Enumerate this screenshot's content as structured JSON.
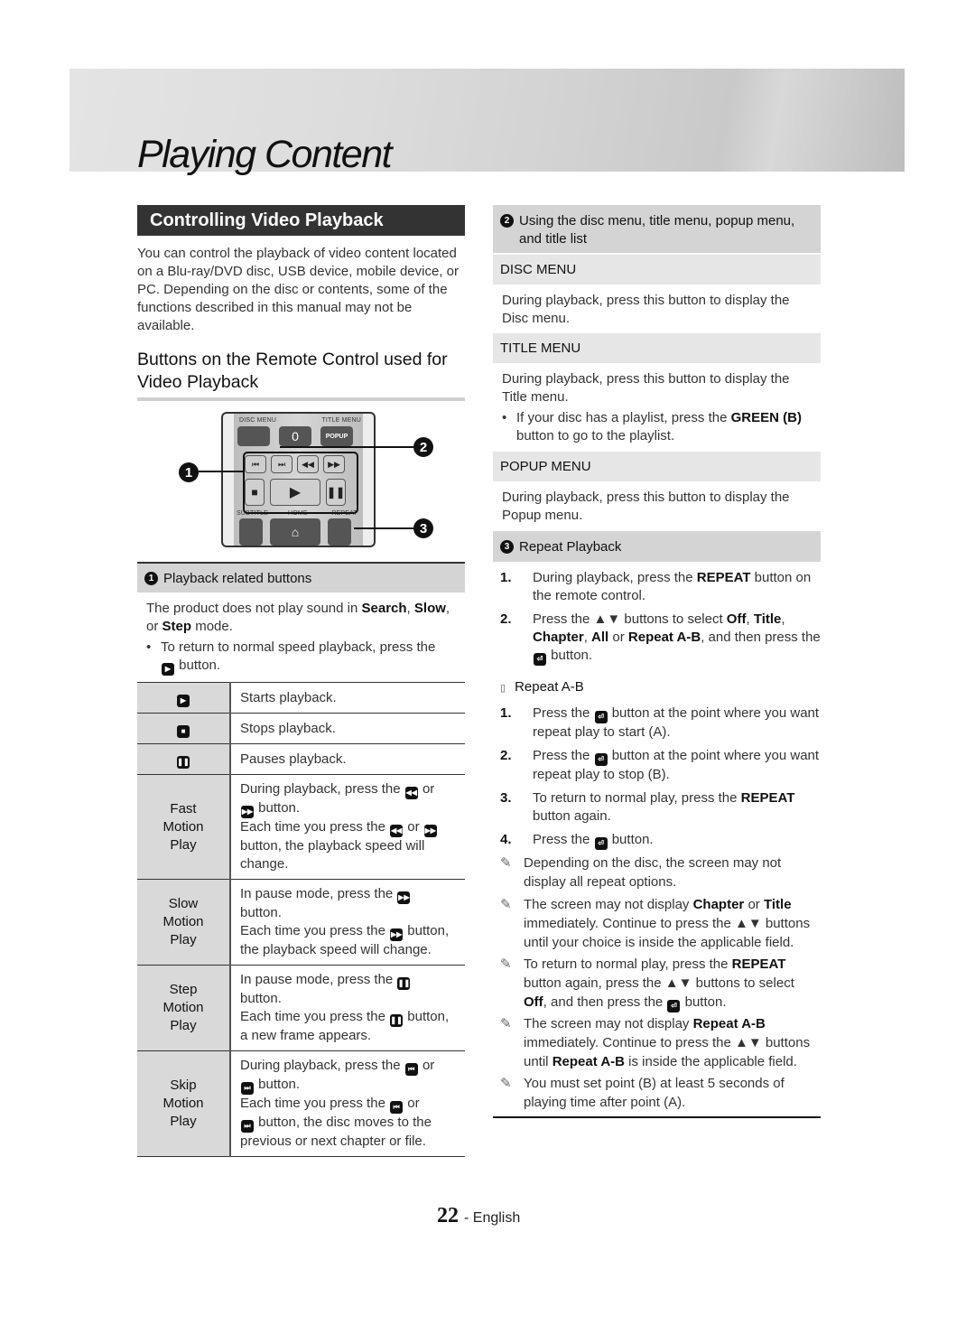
{
  "header": {
    "title": "Playing Content"
  },
  "left": {
    "section_title": "Controlling Video Playback",
    "intro": "You can control the playback of video content located on a Blu-ray/DVD disc, USB device, mobile device, or PC. Depending on the disc or contents, some of the functions described in this manual may not be available.",
    "sub_heading": "Buttons on the Remote Control used for Video Playback",
    "remote": {
      "labels": {
        "disc_menu": "DISC MENU",
        "title_menu": "TITLE MENU",
        "subtitle": "SUBTITLE",
        "home": "HOME",
        "repeat": "REPEAT"
      },
      "buttons": {
        "zero": "0",
        "popup": "POPUP"
      },
      "callouts": [
        "1",
        "2",
        "3"
      ]
    },
    "playback_heading": {
      "num": "1",
      "text": "Playback related buttons"
    },
    "playback_note_pre": "The product does not play sound in ",
    "playback_note_b1": "Search",
    "playback_note_sep1": ", ",
    "playback_note_b2": "Slow",
    "playback_note_sep2": ",",
    "playback_note_or": "or ",
    "playback_note_b3": "Step",
    "playback_note_post": " mode.",
    "bullet_pre": "To return to normal speed playback, press the",
    "bullet_post": "button.",
    "table": {
      "rows": [
        {
          "icon": "play-icon",
          "desc": "Starts playback."
        },
        {
          "icon": "stop-icon",
          "desc": "Stops playback."
        },
        {
          "icon": "pause-icon",
          "desc": "Pauses playback."
        },
        {
          "label": [
            "Fast",
            "Motion",
            "Play"
          ],
          "l1a": "During playback, press the",
          "l1b": "or",
          "l1c": "button.",
          "l2a": "Each time you press the",
          "l2b": "or",
          "l2c": "button, the playback speed will change."
        },
        {
          "label": [
            "Slow",
            "Motion",
            "Play"
          ],
          "l1a": "In pause mode, press the",
          "l1c": "button.",
          "l2a": "Each time you press the",
          "l2c": "button, the playback speed will change."
        },
        {
          "label": [
            "Step",
            "Motion",
            "Play"
          ],
          "l1a": "In pause mode, press the",
          "l1c": "button.",
          "l2a": "Each time you press the",
          "l2c": "button, a new frame appears."
        },
        {
          "label": [
            "Skip",
            "Motion",
            "Play"
          ],
          "l1a": "During playback, press the",
          "l1b": "or",
          "l1c": "button.",
          "l2a": "Each time you press the",
          "l2b": "or",
          "l2c": "button, the disc moves to the previous or next chapter or file."
        }
      ]
    }
  },
  "right": {
    "menu_heading": {
      "num": "2",
      "text": "Using the disc menu, title menu, popup menu, and title list"
    },
    "disc_menu": {
      "title": "DISC MENU",
      "desc": "During playback, press this button to display the Disc menu."
    },
    "title_menu": {
      "title": "TITLE MENU",
      "desc": "During playback, press this button to display the Title menu.",
      "bullet_pre": "If your disc has a playlist, press the ",
      "bullet_b": "GREEN (B)",
      "bullet_post": " button to go to the playlist."
    },
    "popup_menu": {
      "title": "POPUP MENU",
      "desc": "During playback, press this button to display the Popup menu."
    },
    "repeat_heading": {
      "num": "3",
      "text": "Repeat Playback"
    },
    "repeat_steps": {
      "s1_n": "1.",
      "s1_pre": "During playback, press the ",
      "s1_b": "REPEAT",
      "s1_post": " button on the remote control.",
      "s2_n": "2.",
      "s2_pre": "Press the ▲▼ buttons to select ",
      "s2_b1": "Off",
      "s2_b2": "Title",
      "s2_b3": "Chapter",
      "s2_b4": "All",
      "s2_b5": "Repeat A-B",
      "s2_mid": ", and then press the",
      "s2_post": "button."
    },
    "repeat_ab": {
      "marker": "▯",
      "title": "Repeat A-B",
      "s1_n": "1.",
      "s1_pre": "Press the",
      "s1_post": "button at the point where you want repeat play to start (A).",
      "s2_n": "2.",
      "s2_pre": "Press the",
      "s2_post": "button at the point where you want repeat play to stop (B).",
      "s3_n": "3.",
      "s3_pre": "To return to normal play, press the ",
      "s3_b": "REPEAT",
      "s3_post": " button again.",
      "s4_n": "4.",
      "s4_pre": "Press the",
      "s4_post": "button."
    },
    "notes": {
      "n1": "Depending on the disc, the screen may not display all repeat options.",
      "n2_pre": "The screen may not display ",
      "n2_b1": "Chapter",
      "n2_or": " or ",
      "n2_b2": "Title",
      "n2_post": " immediately. Continue to press the ▲▼ buttons until your choice is inside the applicable field.",
      "n3_pre": "To return to normal play, press the ",
      "n3_b1": "REPEAT",
      "n3_mid": " button again, press the ▲▼ buttons to select ",
      "n3_b2": "Off",
      "n3_mid2": ", and then press the",
      "n3_post": "button.",
      "n4_pre": "The screen may not display ",
      "n4_b1": "Repeat A-B",
      "n4_mid": " immediately. Continue to press the ▲▼ buttons until ",
      "n4_b2": "Repeat A-B",
      "n4_post": " is inside the applicable field.",
      "n5": "You must set point (B) at least 5 seconds of playing time after point (A)."
    }
  },
  "footer": {
    "page_number": "22",
    "language": "- English"
  }
}
